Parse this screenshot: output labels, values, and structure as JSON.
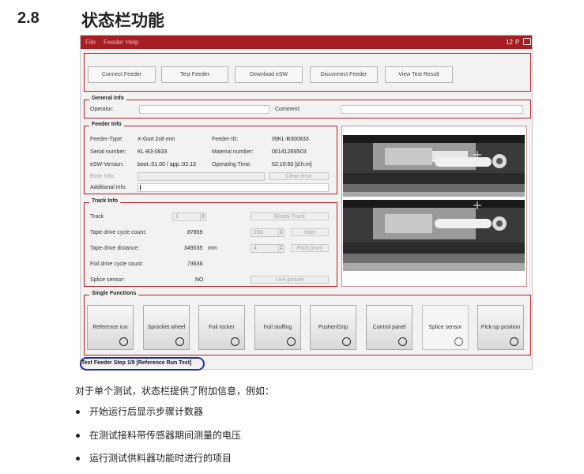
{
  "doc": {
    "section_number": "2.8",
    "section_title": "状态栏功能",
    "intro": "对于单个测试，状态栏提供了附加信息，例如：",
    "bullets": [
      "开始运行后显示步骤计数器",
      "在测试接料带传感器期间测量的电压",
      "运行测试供料器功能时进行的项目"
    ]
  },
  "app": {
    "menu": [
      "File",
      "Feeder",
      "Help"
    ],
    "menu_right": {
      "number": "12",
      "letter": "P"
    },
    "toolbar": [
      "Connect Feeder",
      "Test Feeder",
      "Download eSW",
      "Disconnect Feeder",
      "View Test Result"
    ],
    "general_info": {
      "title": "General Info",
      "operator_label": "Operator:",
      "comment_label": "Comment:",
      "operator_value": "",
      "comment_value": ""
    },
    "feeder_info": {
      "title": "Feeder Info",
      "rows": [
        {
          "label": "Feeder-Type:",
          "value": "X-Gurt 2x8 mm",
          "label2": "Feeder-ID:",
          "value2": "09KL-B300833"
        },
        {
          "label": "Serial number:",
          "value": "KL-B3-0833",
          "label2": "Material number:",
          "value2": "00141269S03"
        },
        {
          "label": "eSW-Version:",
          "value": "boot.:01.00 / app.:02.13",
          "label2": "Operating Time:",
          "value2": "52:10:50 [d:h:m]"
        }
      ],
      "error_label": "Error Info:",
      "clear_error": "Clear error",
      "additional_label": "Additional Info:"
    },
    "track_info": {
      "title": "Track Info",
      "track_label": "Track",
      "track_value": "1",
      "empty_track": "Empty Track",
      "tape_cycle_label": "Tape drive cycle count:",
      "tape_cycle_value": "87859",
      "cycle_spin": "200",
      "start": "Start",
      "tape_distance_label": "Tape drive distance:",
      "tape_distance_value": "349035",
      "tape_distance_unit": "mm",
      "pitch_spin": "4",
      "pitch": "Pitch [mm]",
      "foil_cycle_label": "Foil drive cycle count:",
      "foil_cycle_value": "73636",
      "splice_label": "Splice sensor:",
      "splice_value": "NO",
      "live_picture": "Live picture"
    },
    "single_functions": {
      "title": "Single Functions",
      "buttons": [
        "Reference run",
        "Sprocket wheel",
        "Foil rocker",
        "Foil stuffing",
        "Pusher/Grip",
        "Control panel",
        "Splice sensor",
        "Pick-up position"
      ]
    },
    "status_bar": "Test Feeder Step 1/9 [Reference Run Test]",
    "colors": {
      "accent": "#a61e23",
      "status_oval": "#1d2fa3"
    }
  }
}
